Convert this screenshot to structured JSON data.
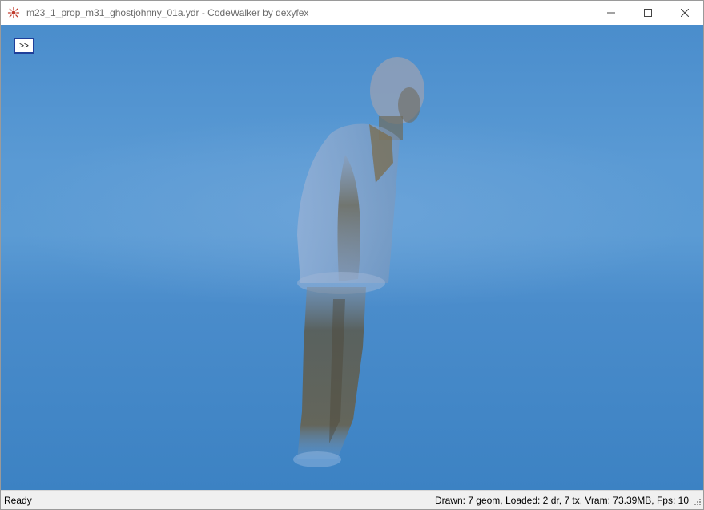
{
  "window": {
    "title": "m23_1_prop_m31_ghostjohnny_01a.ydr - CodeWalker by dexyfex",
    "app_icon": "codewalker-icon",
    "controls": [
      "minimize-icon",
      "maximize-icon",
      "close-icon"
    ]
  },
  "viewport": {
    "toggle_label": ">>",
    "background_color": "#4a8dcc"
  },
  "statusbar": {
    "left_text": "Ready",
    "right_text": "Drawn: 7 geom, Loaded: 2 dr, 7 tx, Vram: 73.39MB, Fps: 10"
  }
}
